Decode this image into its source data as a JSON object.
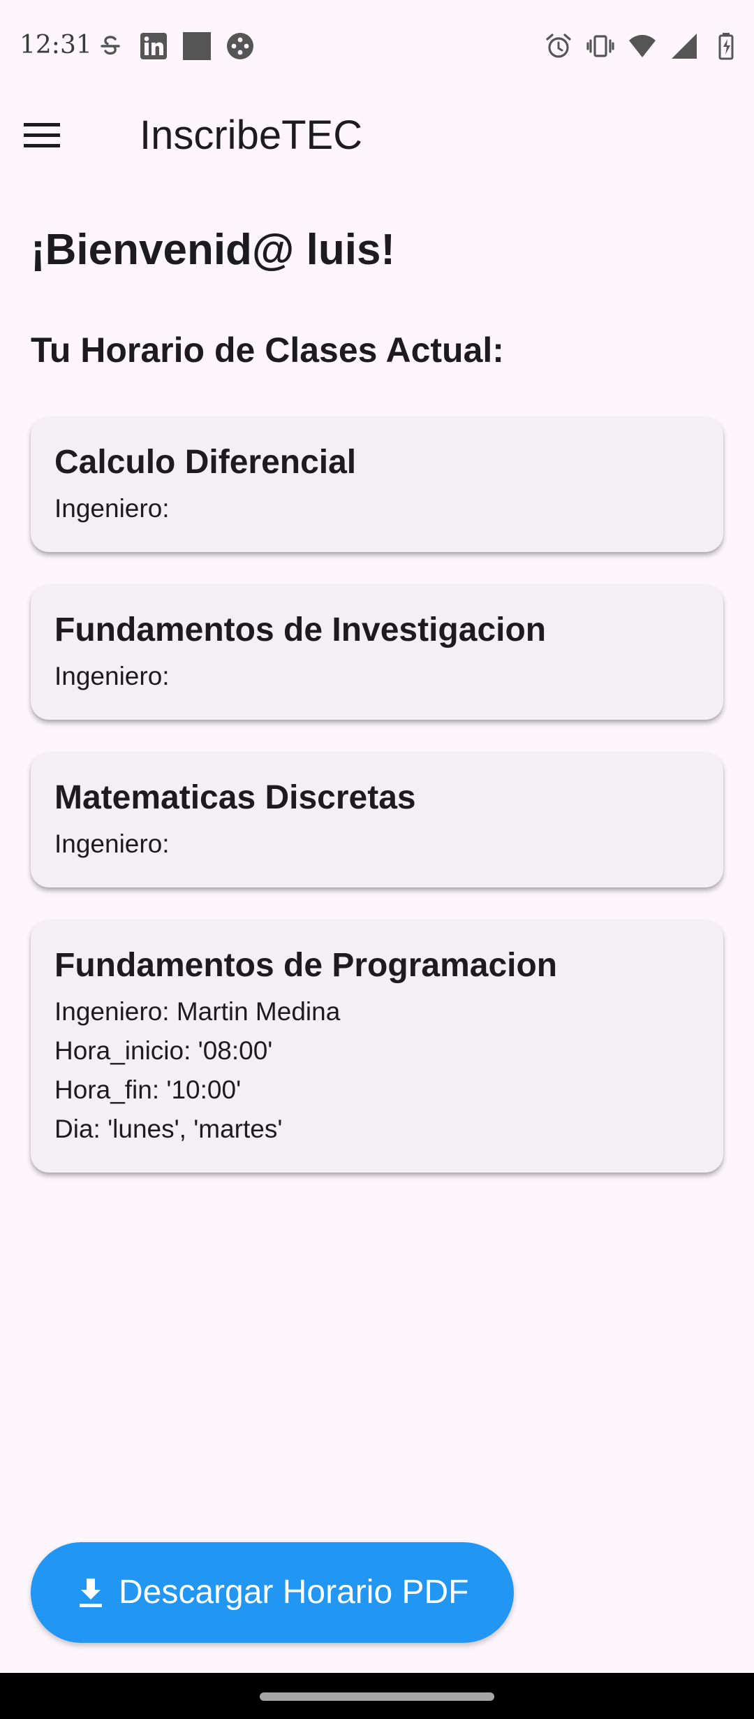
{
  "status_bar": {
    "time": "12:31",
    "left_icons": [
      "strikethrough-s-icon",
      "linkedin-icon",
      "square-icon",
      "gamepad-icon"
    ],
    "right_icons": [
      "alarm-icon",
      "vibrate-icon",
      "wifi-icon",
      "signal-icon",
      "battery-charging-icon"
    ]
  },
  "app_bar": {
    "title": "InscribeTEC",
    "menu_icon": "menu-icon"
  },
  "main": {
    "welcome": "¡Bienvenid@ luis!",
    "schedule_heading": "Tu Horario de Clases Actual:",
    "courses": [
      {
        "title": "Calculo Diferencial",
        "lines": [
          "Ingeniero:"
        ]
      },
      {
        "title": "Fundamentos de Investigacion",
        "lines": [
          "Ingeniero:"
        ]
      },
      {
        "title": "Matematicas Discretas",
        "lines": [
          "Ingeniero:"
        ]
      },
      {
        "title": "Fundamentos de Programacion",
        "lines": [
          "Ingeniero: Martin Medina",
          "Hora_inicio: '08:00'",
          "Hora_fin: '10:00'",
          "Dia: 'lunes', 'martes'"
        ]
      }
    ]
  },
  "fab": {
    "label": "Descargar Horario PDF",
    "icon": "download-icon"
  },
  "colors": {
    "background": "#fdf7fd",
    "card": "#f4eff5",
    "fab": "#2196f3",
    "text": "#1d1b20"
  }
}
